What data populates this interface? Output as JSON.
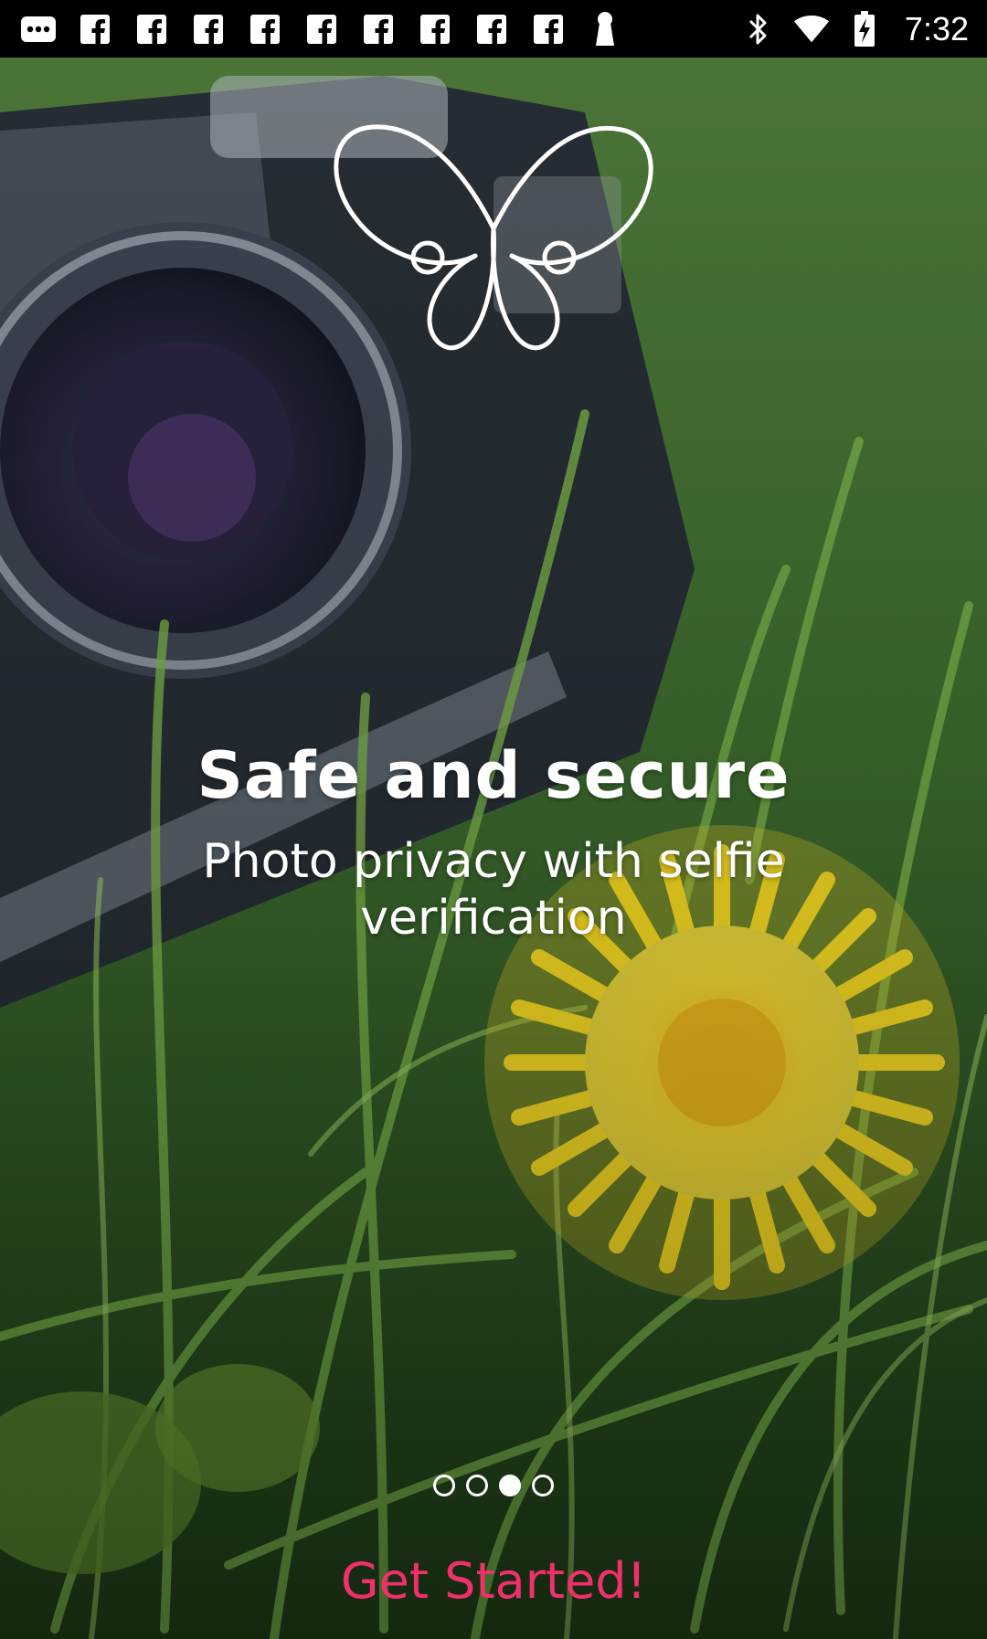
{
  "status_bar": {
    "time": "7:32",
    "left_icons": [
      "notification-more-icon",
      "facebook-icon",
      "facebook-icon",
      "facebook-icon",
      "facebook-icon",
      "facebook-icon",
      "facebook-icon",
      "facebook-icon",
      "facebook-icon",
      "facebook-icon",
      "keyhole-icon"
    ],
    "right_icons": [
      "bluetooth-icon",
      "wifi-icon",
      "battery-charging-icon"
    ]
  },
  "onboarding": {
    "headline": "Safe and secure",
    "subline": "Photo privacy with selfie verification",
    "page_count": 4,
    "active_page": 3,
    "cta_label": "Get Started!"
  },
  "colors": {
    "accent": "#f0306a",
    "text": "#ffffff",
    "status_bar_bg": "#000000"
  }
}
